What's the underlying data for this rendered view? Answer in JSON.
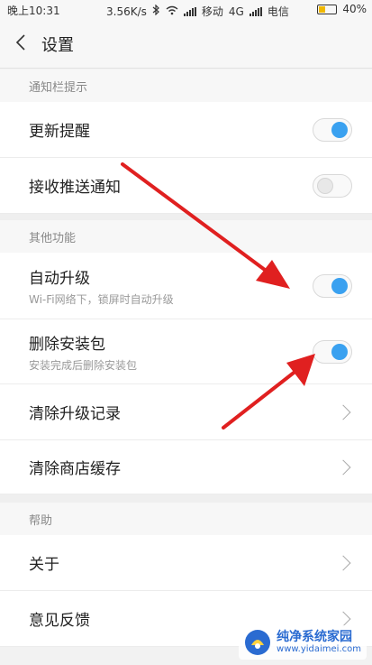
{
  "status_bar": {
    "time": "晚上10:31",
    "speed": "3.56K/s",
    "carrier1": "移动",
    "network": "4G",
    "carrier2": "电信",
    "battery": "40%",
    "battery_level": 0.4
  },
  "header": {
    "title": "设置",
    "back_icon": "chevron-left-icon"
  },
  "sections": {
    "notify": {
      "header": "通知栏提示",
      "update_reminder": {
        "label": "更新提醒",
        "enabled": true
      },
      "push_notify": {
        "label": "接收推送通知",
        "enabled": false
      }
    },
    "other": {
      "header": "其他功能",
      "auto_upgrade": {
        "label": "自动升级",
        "sub": "Wi-Fi网络下，锁屏时自动升级",
        "enabled": true
      },
      "delete_package": {
        "label": "删除安装包",
        "sub": "安装完成后删除安装包",
        "enabled": true
      },
      "clear_upgrade_log": {
        "label": "清除升级记录"
      },
      "clear_store_cache": {
        "label": "清除商店缓存"
      }
    },
    "help": {
      "header": "帮助",
      "about": {
        "label": "关于"
      },
      "feedback": {
        "label": "意见反馈"
      }
    }
  },
  "watermark": {
    "title": "纯净系统家园",
    "url": "www.yidaimei.com"
  },
  "colors": {
    "toggle_on": "#3aa1f0",
    "annotation_arrow": "#e02020"
  }
}
